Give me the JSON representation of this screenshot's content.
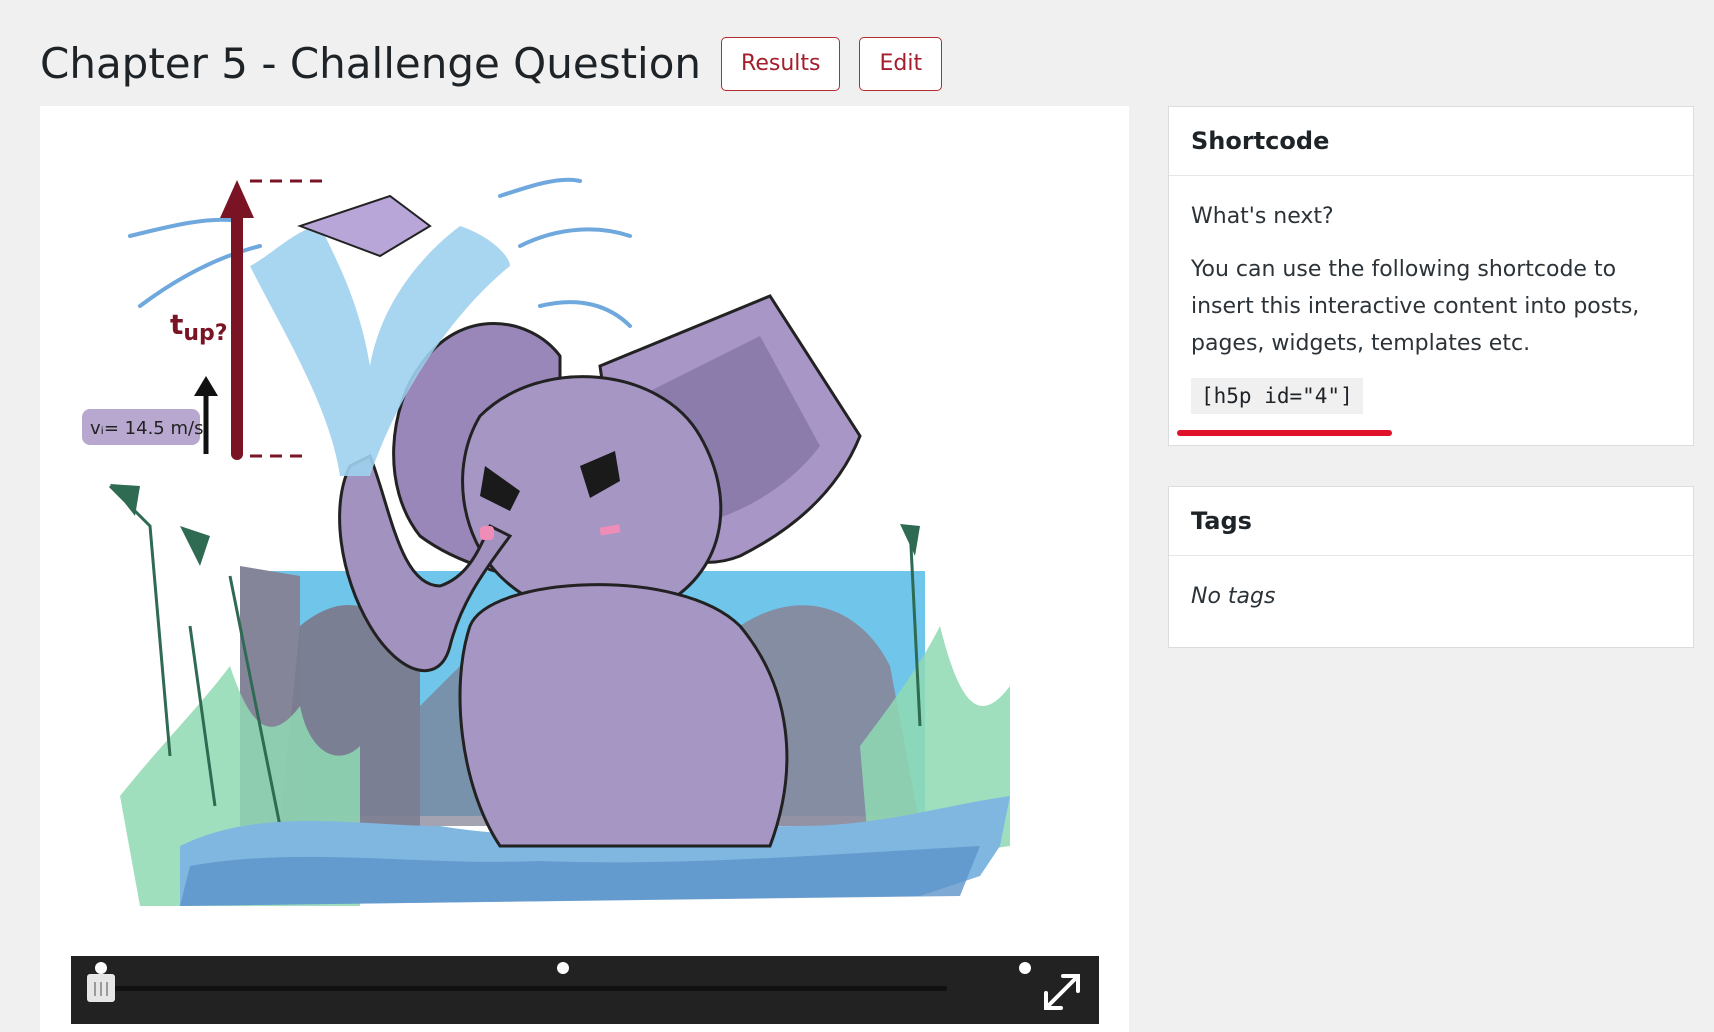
{
  "header": {
    "title": "Chapter 5 - Challenge Question",
    "results_label": "Results",
    "edit_label": "Edit"
  },
  "illustration": {
    "time_label": "t",
    "time_subscript": "up?",
    "velocity_label": "vᵢ= 14.5 m/s"
  },
  "player": {
    "progress_fraction": 0.0
  },
  "shortcode_box": {
    "title": "Shortcode",
    "whats_next": "What's next?",
    "description": "You can use the following shortcode to insert this interactive content into posts, pages, widgets, templates etc.",
    "shortcode": "[h5p id=\"4\"]"
  },
  "tags_box": {
    "title": "Tags",
    "empty_text": "No tags"
  },
  "colors": {
    "accent": "#a31d2c",
    "highlight_underline": "#e0112b",
    "player_bg": "#222222"
  }
}
